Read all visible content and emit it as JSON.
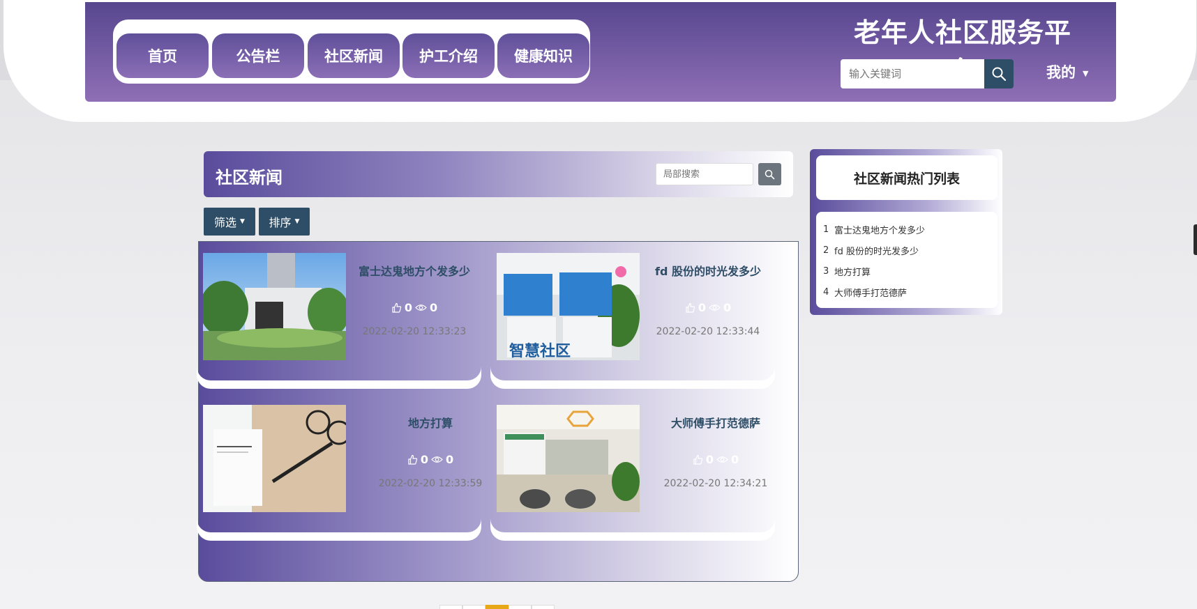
{
  "header": {
    "site_title": "老年人社区服务平台",
    "nav": [
      "首页",
      "公告栏",
      "社区新闻",
      "护工介绍",
      "健康知识"
    ],
    "search_placeholder": "输入关键词",
    "user_menu": "我的"
  },
  "section": {
    "title": "社区新闻",
    "local_search_placeholder": "局部搜索",
    "filter_label": "筛选",
    "sort_label": "排序"
  },
  "news": [
    {
      "title": "富士达鬼地方个发多少",
      "likes": "0",
      "views": "0",
      "date": "2022-02-20 12:33:23"
    },
    {
      "title": "fd 股份的时光发多少",
      "likes": "0",
      "views": "0",
      "date": "2022-02-20 12:33:44"
    },
    {
      "title": "地方打算",
      "likes": "0",
      "views": "0",
      "date": "2022-02-20 12:33:59"
    },
    {
      "title": "大师傅手打范德萨",
      "likes": "0",
      "views": "0",
      "date": "2022-02-20 12:34:21"
    }
  ],
  "sidebar": {
    "title": "社区新闻热门列表",
    "items": [
      {
        "idx": "1",
        "label": "富士达鬼地方个发多少"
      },
      {
        "idx": "2",
        "label": "fd 股份的时光发多少"
      },
      {
        "idx": "3",
        "label": "地方打算"
      },
      {
        "idx": "4",
        "label": "大师傅手打范德萨"
      }
    ]
  },
  "thumbnail_text": {
    "card2_chars": "智慧社区"
  },
  "colors": {
    "purple_dark": "#57478f",
    "purple_light": "#8f6fb5",
    "button_navy": "#2e4d66",
    "pagination_active": "#e6a817"
  }
}
